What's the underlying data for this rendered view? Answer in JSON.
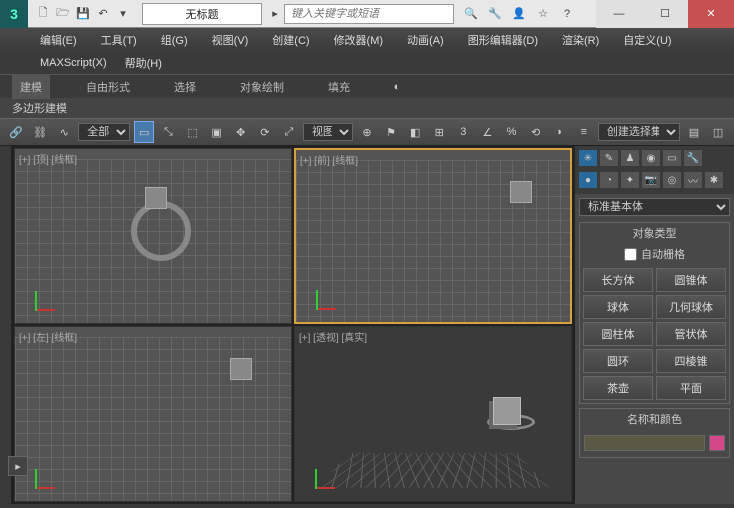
{
  "titlebar": {
    "title": "无标题",
    "search_placeholder": "键入关键字或短语"
  },
  "menu": {
    "edit": "编辑(E)",
    "tools": "工具(T)",
    "group": "组(G)",
    "views": "视图(V)",
    "create": "创建(C)",
    "modifiers": "修改器(M)",
    "animation": "动画(A)",
    "graph": "图形编辑器(D)",
    "render": "渲染(R)",
    "custom": "自定义(U)",
    "maxscript": "MAXScript(X)",
    "help": "帮助(H)"
  },
  "ribbon": {
    "modeling": "建模",
    "freeform": "自由形式",
    "select": "选择",
    "objpaint": "对象绘制",
    "fill": "填充",
    "sub": "多边形建模"
  },
  "toolbar": {
    "all_label": "全部",
    "view_label": "视图",
    "sel_set_label": "创建选择集"
  },
  "viewports": {
    "tl": "[+] [顶] [线框]",
    "tr": "[+] [前] [线框]",
    "bl": "[+] [左] [线框]",
    "br": "[+] [透视] [真实]"
  },
  "panel": {
    "dropdown": "标准基本体",
    "obj_type_title": "对象类型",
    "autogrid": "自动栅格",
    "btns": {
      "box": "长方体",
      "cone": "圆锥体",
      "sphere": "球体",
      "geosphere": "几何球体",
      "cylinder": "圆柱体",
      "tube": "管状体",
      "torus": "圆环",
      "pyramid": "四棱锥",
      "teapot": "茶壶",
      "plane": "平面"
    },
    "name_color_title": "名称和颜色"
  }
}
